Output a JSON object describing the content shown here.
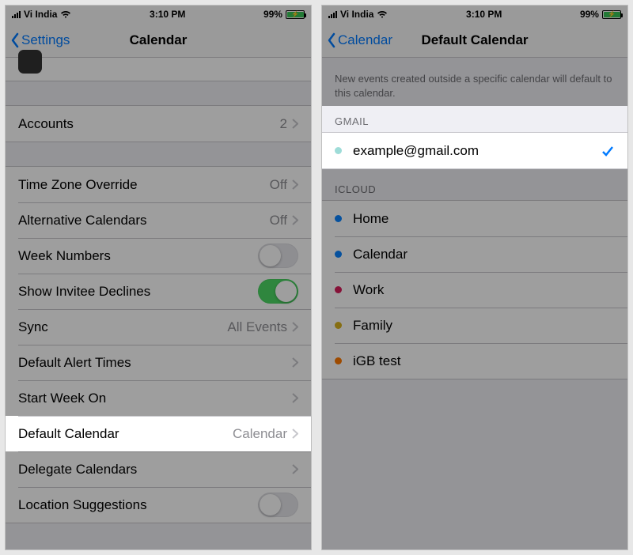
{
  "left": {
    "status": {
      "carrier": "Vi India",
      "time": "3:10 PM",
      "battery": "99%"
    },
    "nav": {
      "back": "Settings",
      "title": "Calendar"
    },
    "accounts": {
      "label": "Accounts",
      "value": "2"
    },
    "rows": {
      "tzo": {
        "label": "Time Zone Override",
        "value": "Off"
      },
      "alt": {
        "label": "Alternative Calendars",
        "value": "Off"
      },
      "week": {
        "label": "Week Numbers"
      },
      "inv": {
        "label": "Show Invitee Declines"
      },
      "sync": {
        "label": "Sync",
        "value": "All Events"
      },
      "alert": {
        "label": "Default Alert Times"
      },
      "start": {
        "label": "Start Week On"
      },
      "defcal": {
        "label": "Default Calendar",
        "value": "Calendar"
      },
      "deleg": {
        "label": "Delegate Calendars"
      },
      "loc": {
        "label": "Location Suggestions"
      }
    }
  },
  "right": {
    "status": {
      "carrier": "Vi India",
      "time": "3:10 PM",
      "battery": "99%"
    },
    "nav": {
      "back": "Calendar",
      "title": "Default Calendar"
    },
    "desc": "New events created outside a specific calendar will default to this calendar.",
    "gmail": {
      "header": "GMAIL",
      "item": {
        "label": "example@gmail.com",
        "dot": "#9edcd8"
      }
    },
    "icloud": {
      "header": "ICLOUD",
      "items": [
        {
          "label": "Home",
          "dot": "#0a84ff"
        },
        {
          "label": "Calendar",
          "dot": "#0a84ff"
        },
        {
          "label": "Work",
          "dot": "#d81e5b"
        },
        {
          "label": "Family",
          "dot": "#d8b21e"
        },
        {
          "label": "iGB test",
          "dot": "#ff7a00"
        }
      ]
    }
  }
}
